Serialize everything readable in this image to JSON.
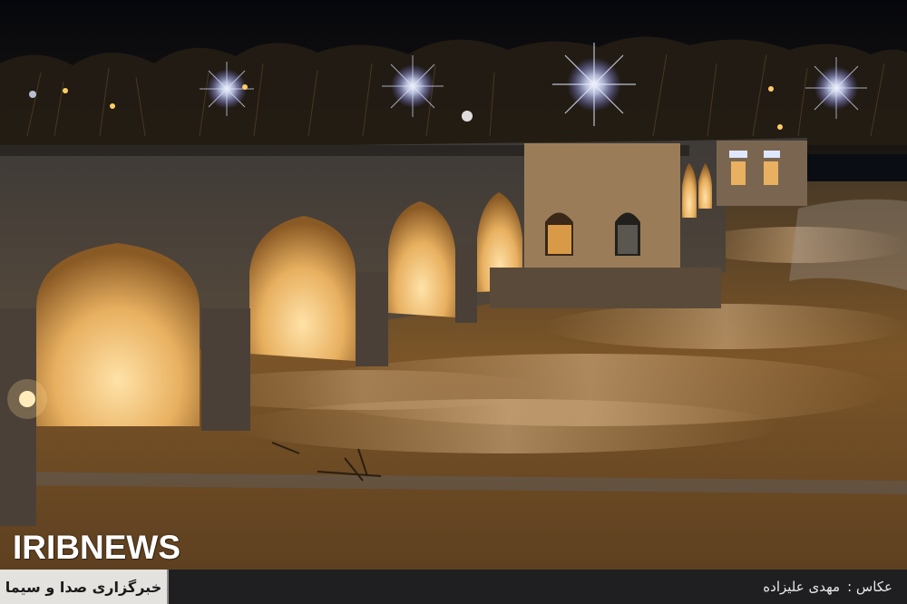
{
  "watermark": {
    "text": "IRIBNEWS"
  },
  "caption_bar": {
    "agency": "خبرگزاری صدا و سیما",
    "credit_label": "عکاس  :",
    "credit_name": "مهدی علیزاده"
  },
  "colors": {
    "sky": "#0b0d14",
    "arch_glow": "#f2c77a",
    "river": "#8a5a2a",
    "bar": "#1f1f21",
    "agency_box": "#e4e2de"
  }
}
